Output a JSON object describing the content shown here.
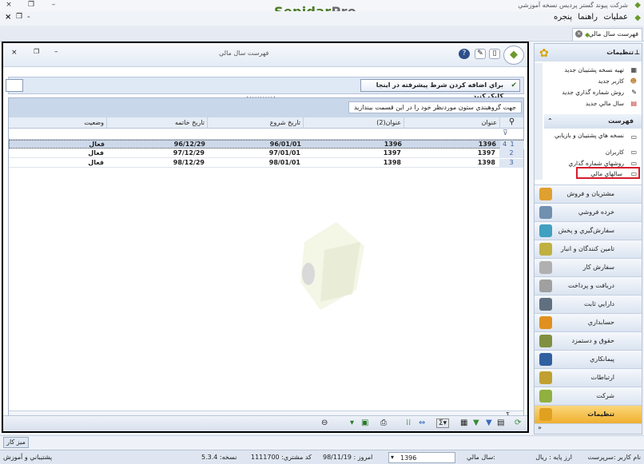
{
  "window": {
    "app_title": "شرکت پيوند گستر پرديس نسخه آموزشي",
    "brand_main": "Sepidar",
    "brand_suffix": "Pro"
  },
  "menu": {
    "operations": "عمليات",
    "help": "راهنما",
    "window": "پنجره"
  },
  "tab": {
    "label": "فهرست سال مالي"
  },
  "panel": {
    "title": "فهرست سال مالي",
    "filter_button": "براي اضافه کردن شرط پيشرفته در اينجا کليک کنيد",
    "group_hint": "جهت گروهبندي ستون موردنظر خود را در اين قسمت بيندازيد"
  },
  "grid": {
    "columns": [
      "عنوان",
      "عنوان(2)",
      "تاريخ شروع",
      "تاريخ خاتمه",
      "وضعيت"
    ],
    "rows": [
      {
        "num": "1",
        "mark": "4",
        "title": "1396",
        "title2": "1396",
        "start": "96/01/01",
        "end": "96/12/29",
        "status": "فعال"
      },
      {
        "num": "2",
        "mark": "",
        "title": "1397",
        "title2": "1397",
        "start": "97/01/01",
        "end": "97/12/29",
        "status": "فعال"
      },
      {
        "num": "3",
        "mark": "",
        "title": "1398",
        "title2": "1398",
        "start": "98/01/01",
        "end": "98/12/29",
        "status": "فعال"
      }
    ],
    "footer_sigma": "Σ"
  },
  "sidebar": {
    "settings_header": "تنظيمات",
    "settings_items": [
      "تهيه نسخه پشتيبان جديد",
      "کاربر جديد",
      "روش شماره گذاري جديد",
      "سال مالي جديد"
    ],
    "list_header": "فهرست",
    "list_items": [
      "نسخه هاي پشتيبان و بازيابي",
      "کاربران",
      "روشهاي شماره گذاري",
      "سالهاي مالي"
    ],
    "modules": [
      "مشتريان و فروش",
      "خرده فروشي",
      "سفارش‌گيري و پخش",
      "تامين کنندگان و انبار",
      "سفارش کار",
      "دريافت و پرداخت",
      "دارايي ثابت",
      "حسابداري",
      "حقوق و دستمزد",
      "پيمانکاري",
      "ارتباطات",
      "شرکت",
      "تنظيمات"
    ]
  },
  "taskbar": {
    "desk": "ميز کار"
  },
  "status": {
    "user_label": "نام کاربر :سرپرست",
    "currency": "ارز پايه : ريال",
    "fiscal_label": "سال مالي:",
    "fiscal_value": "1396",
    "today": "امروز : 98/11/19",
    "customer_code": "کد مشتري: 1111700",
    "version": "نسخه: 5.3.4",
    "support": "پشتيباني و آموزش"
  }
}
